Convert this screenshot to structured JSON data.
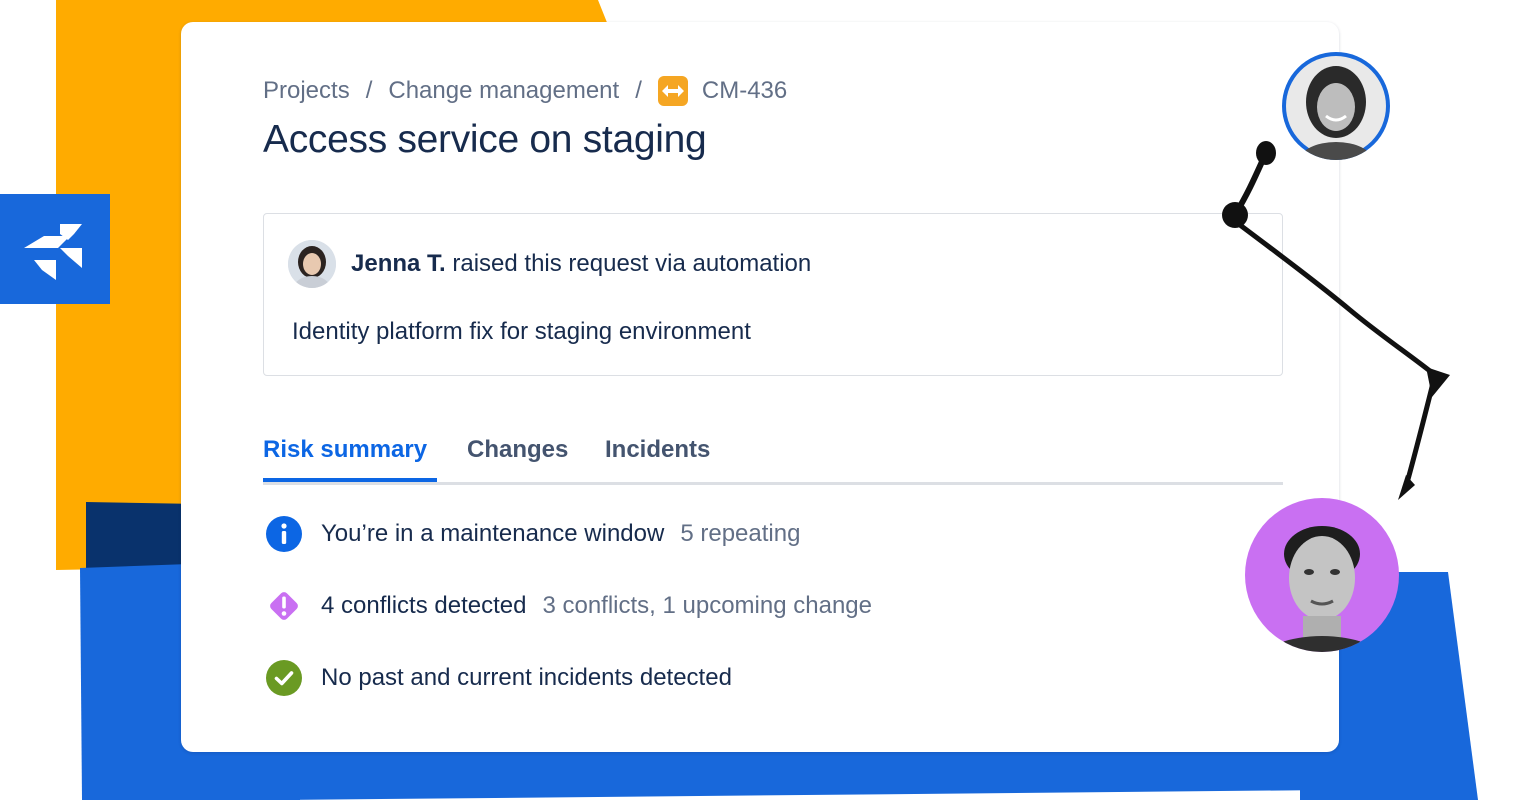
{
  "colors": {
    "yellow_panel": "#FFAB00",
    "blue_panel": "#1868DB",
    "navy_panel": "#09326C",
    "accent": "#0C66E4",
    "purple": "#C970F2"
  },
  "brand": {
    "logo_icon": "jira-service-management-icon"
  },
  "breadcrumb": {
    "items": [
      "Projects",
      "Change management"
    ],
    "separator": "/",
    "issue_key": "CM-436",
    "issue_icon": "change-arrows-icon"
  },
  "page_title": "Access service on staging",
  "request": {
    "author": "Jenna T.",
    "action": " raised this request via automation",
    "description": "Identity platform fix for staging environment"
  },
  "tabs": [
    {
      "label": "Risk summary",
      "active": true
    },
    {
      "label": "Changes",
      "active": false
    },
    {
      "label": "Incidents",
      "active": false
    }
  ],
  "risk_items": [
    {
      "icon": "info-icon",
      "text": "You’re in a maintenance window",
      "detail": "5 repeating"
    },
    {
      "icon": "warning-diamond-icon",
      "text": "4 conflicts detected",
      "detail": "3 conflicts, 1 upcoming change"
    },
    {
      "icon": "check-circle-icon",
      "text": "No past and current incidents detected",
      "detail": ""
    }
  ]
}
